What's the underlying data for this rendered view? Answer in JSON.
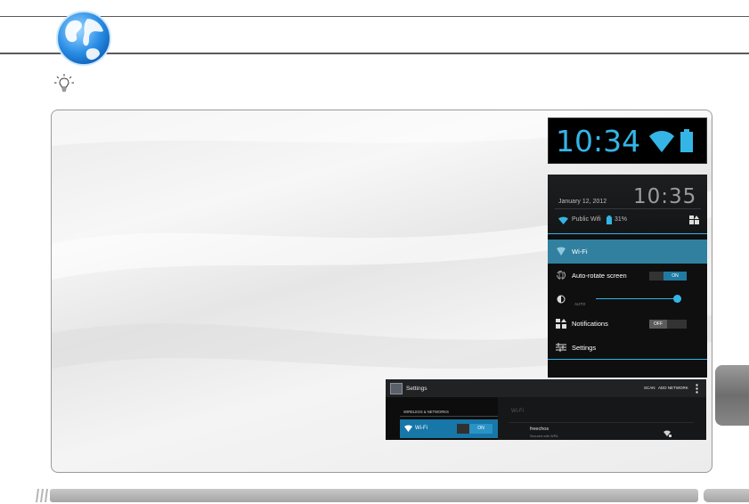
{
  "status_bar": {
    "time": "10:34",
    "icons": [
      "wifi-icon",
      "battery-icon"
    ]
  },
  "notification_panel": {
    "date": "January 12, 2012",
    "time": "10:35",
    "network": "Public Wifi",
    "battery": "31%",
    "rows": [
      {
        "label": "Wi-Fi",
        "icon": "wifi-triangle-icon"
      },
      {
        "label": "Auto-rotate screen",
        "icon": "rotate-icon",
        "toggle": "ON"
      },
      {
        "label": "",
        "icon": "brightness-icon",
        "sub_label": "AUTO"
      },
      {
        "label": "Notifications",
        "icon": "notifications-icon",
        "toggle": "OFF"
      },
      {
        "label": "Settings",
        "icon": "settings-sliders-icon"
      }
    ],
    "brightness_level": 0.95
  },
  "settings_screen": {
    "title": "Settings",
    "actions": {
      "scan": "SCAN",
      "add_network": "ADD NETWORK"
    },
    "section_header": "WIRELESS & NETWORKS",
    "wifi_label": "Wi-Fi",
    "wifi_toggle": "ON",
    "right_header": "Wi-Fi",
    "network": {
      "name": "freechos",
      "status": "Secured with WPA"
    }
  },
  "colors": {
    "accent": "#33b5e5",
    "wifi_row": "#31809f",
    "panel_bg": "#0f0f10"
  }
}
